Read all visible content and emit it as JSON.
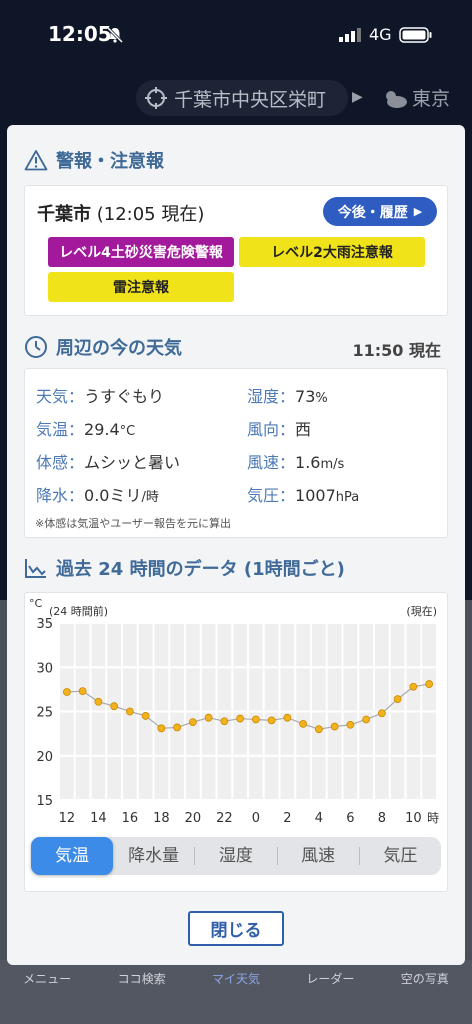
{
  "status": {
    "time": "12:05",
    "network": "4G"
  },
  "background": {
    "location": "千葉市中央区栄町",
    "weather_place": "東京",
    "nav": [
      "メニュー",
      "ココ検索",
      "マイ天気",
      "レーダー",
      "空の写真"
    ]
  },
  "warnings": {
    "title": "警報・注意報",
    "city": "千葉市",
    "as_of": "(12:05 現在)",
    "history_button": "今後・履歴",
    "badges": [
      "レベル4土砂災害危険警報",
      "レベル2大雨注意報",
      "雷注意報"
    ],
    "colors": {
      "level4": "#a2199b",
      "advisory": "#f1e31a"
    }
  },
  "current": {
    "title": "周辺の今の天気",
    "time": "11:50 現在",
    "left": [
      {
        "k": "天気",
        "v": "うすぐもり",
        "u": ""
      },
      {
        "k": "気温",
        "v": "29.4",
        "u": "°C"
      },
      {
        "k": "体感",
        "v": "ムシッと暑い",
        "u": ""
      },
      {
        "k": "降水",
        "v": "0.0ミリ",
        "u": "/時"
      }
    ],
    "right": [
      {
        "k": "湿度",
        "v": "73",
        "u": "%"
      },
      {
        "k": "風向",
        "v": "西",
        "u": ""
      },
      {
        "k": "風速",
        "v": "1.6",
        "u": "m/s"
      },
      {
        "k": "気圧",
        "v": "1007",
        "u": "hPa"
      }
    ],
    "note": "※体感は気温やユーザー報告を元に算出"
  },
  "history": {
    "title": "過去 24 時間のデータ (1時間ごと)",
    "tabs": [
      "気温",
      "降水量",
      "湿度",
      "風速",
      "気圧"
    ],
    "active_tab": 0,
    "close_button": "閉じる"
  },
  "chart_data": {
    "type": "line",
    "unit": "°C",
    "left_note": "(24 時間前)",
    "right_note": "(現在)",
    "ylim": [
      15,
      35
    ],
    "yticks": [
      35,
      30,
      25,
      20,
      15
    ],
    "xticks": [
      "12",
      "14",
      "16",
      "18",
      "20",
      "22",
      "0",
      "2",
      "4",
      "6",
      "8",
      "10"
    ],
    "x_unit": "時",
    "x": [
      "12",
      "13",
      "14",
      "15",
      "16",
      "17",
      "18",
      "19",
      "20",
      "21",
      "22",
      "23",
      "0",
      "1",
      "2",
      "3",
      "4",
      "5",
      "6",
      "7",
      "8",
      "9",
      "10",
      "11"
    ],
    "values": [
      27.2,
      27.3,
      26.1,
      25.6,
      25.0,
      24.5,
      23.1,
      23.2,
      23.8,
      24.3,
      23.9,
      24.2,
      24.1,
      24.0,
      24.3,
      23.6,
      23.0,
      23.3,
      23.5,
      24.1,
      24.8,
      26.4,
      27.8,
      28.1
    ],
    "grid": true,
    "colors": {
      "point": "#f2b21d",
      "line": "#aaaaaa"
    }
  }
}
